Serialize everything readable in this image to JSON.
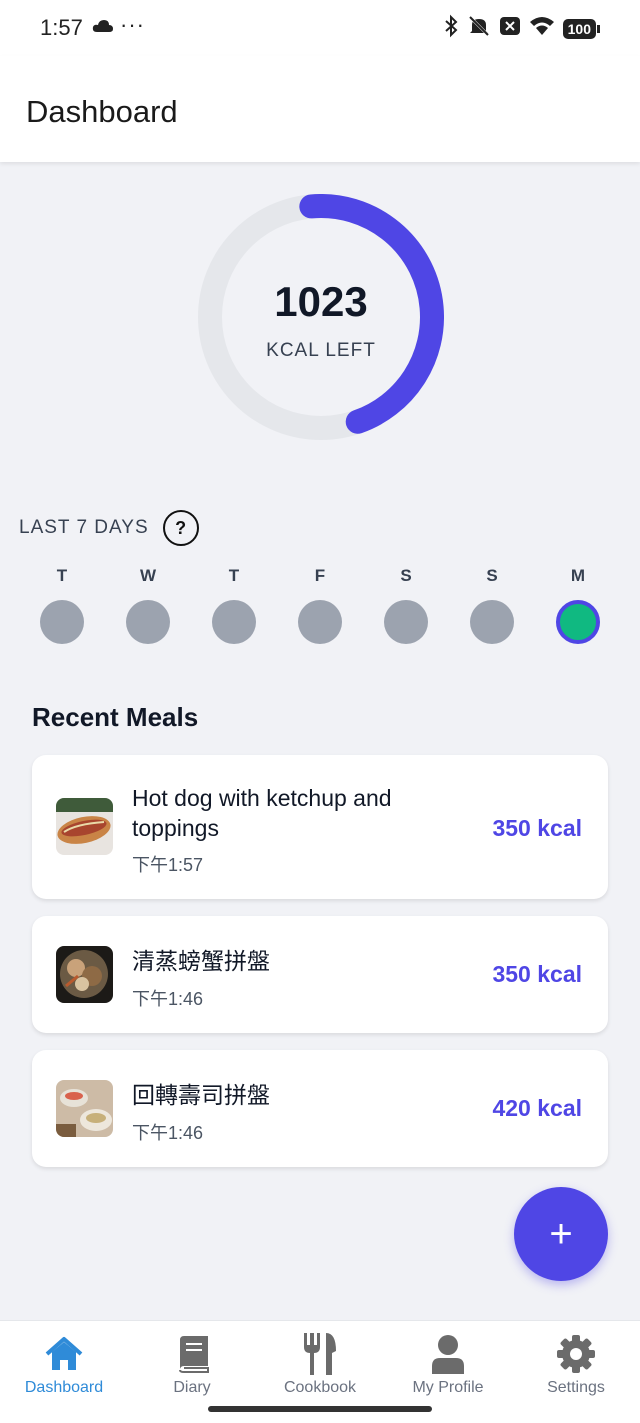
{
  "status_bar": {
    "time": "1:57",
    "dots": "···",
    "battery": "100",
    "icons": [
      "cloud-icon",
      "bluetooth-icon",
      "mute-icon",
      "close-box-icon",
      "wifi-icon",
      "battery-icon"
    ]
  },
  "app_bar": {
    "title": "Dashboard"
  },
  "calories": {
    "value": "1023",
    "label": "KCAL LEFT",
    "progress_fraction": 0.46,
    "accent": "#4F46E5",
    "track": "#E5E7EB"
  },
  "last7": {
    "title": "LAST 7 DAYS",
    "help": "?",
    "days": [
      {
        "letter": "T",
        "active": false
      },
      {
        "letter": "W",
        "active": false
      },
      {
        "letter": "T",
        "active": false
      },
      {
        "letter": "F",
        "active": false
      },
      {
        "letter": "S",
        "active": false
      },
      {
        "letter": "S",
        "active": false
      },
      {
        "letter": "M",
        "active": true
      }
    ]
  },
  "recent": {
    "title": "Recent Meals",
    "meals": [
      {
        "name": "Hot dog with ketchup and toppings",
        "time": "下午1:57",
        "kcal": "350 kcal"
      },
      {
        "name": "清蒸螃蟹拼盤",
        "time": "下午1:46",
        "kcal": "350 kcal"
      },
      {
        "name": "回轉壽司拼盤",
        "time": "下午1:46",
        "kcal": "420 kcal"
      }
    ]
  },
  "fab": {
    "label": "+"
  },
  "nav": [
    {
      "label": "Dashboard",
      "icon": "home-icon",
      "active": true
    },
    {
      "label": "Diary",
      "icon": "book-icon",
      "active": false
    },
    {
      "label": "Cookbook",
      "icon": "fork-knife-icon",
      "active": false
    },
    {
      "label": "My Profile",
      "icon": "person-icon",
      "active": false
    },
    {
      "label": "Settings",
      "icon": "gear-icon",
      "active": false
    }
  ]
}
